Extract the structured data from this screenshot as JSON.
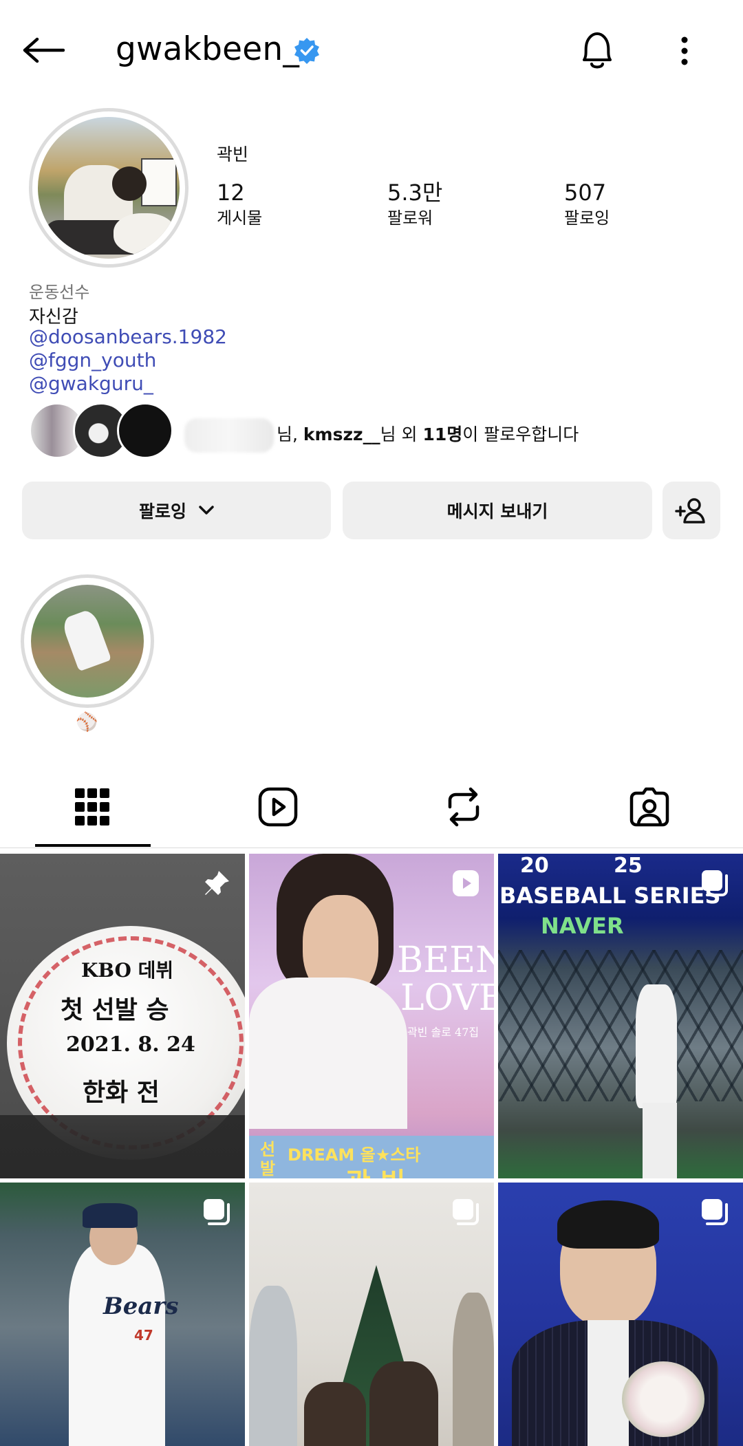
{
  "header": {
    "username": "gwakbeen_",
    "back_icon": "arrow-left-icon",
    "verified_icon": "verified-badge-icon",
    "bell_icon": "bell-icon",
    "more_icon": "more-vertical-icon"
  },
  "profile": {
    "full_name": "곽빈",
    "stats": [
      {
        "value": "12",
        "label": "게시물"
      },
      {
        "value": "5.3만",
        "label": "팔로워"
      },
      {
        "value": "507",
        "label": "팔로잉"
      }
    ],
    "category": "운동선수",
    "bio": "자신감",
    "links": [
      "@doosanbears.1982",
      "@fggn_youth",
      "@gwakguru_"
    ],
    "followed_by": {
      "mid": "님, ",
      "name": "kmszz__",
      "suffix1": "님 외 ",
      "count": "11명",
      "suffix2": "이 팔로우합니다"
    }
  },
  "actions": {
    "following_label": "팔로잉",
    "message_label": "메시지 보내기",
    "add_person_icon": "add-person-icon"
  },
  "highlights": [
    {
      "label": "⚾"
    }
  ],
  "tabs": [
    {
      "name": "grid",
      "icon": "grid-icon",
      "active": true
    },
    {
      "name": "reels",
      "icon": "reels-icon",
      "active": false
    },
    {
      "name": "reposts",
      "icon": "repost-icon",
      "active": false
    },
    {
      "name": "tagged",
      "icon": "tagged-icon",
      "active": false
    }
  ],
  "posts": {
    "p1_text": [
      "KBO 데뷔",
      "첫 선발 승",
      "2021. 8. 24",
      "한화 전"
    ],
    "p2_text": [
      "BEEN",
      "LOVE",
      "곽빈 솔로 47집",
      "선",
      "발",
      "DREAM 올★스타",
      "곽 빈"
    ],
    "p3_text": [
      "20",
      "25",
      "BASEBALL SERIES",
      "NAVER"
    ],
    "p4_text": [
      "Bears",
      "47"
    ],
    "colors": {
      "link": "#3f4cb5",
      "verified": "#3797f0"
    }
  }
}
